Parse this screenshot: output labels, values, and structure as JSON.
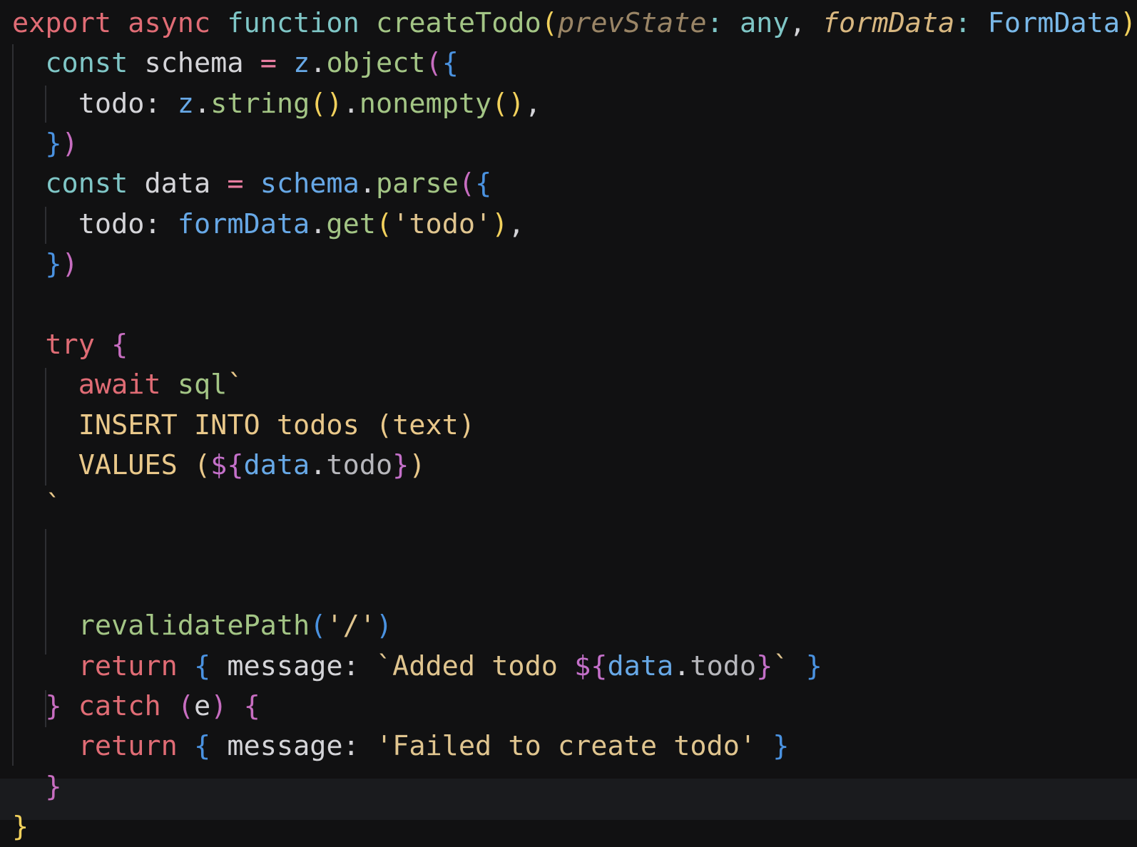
{
  "editor": {
    "lines": [
      [
        {
          "t": "export",
          "c": "kw-red"
        },
        {
          "t": " ",
          "c": "plain"
        },
        {
          "t": "async",
          "c": "kw-red"
        },
        {
          "t": " ",
          "c": "plain"
        },
        {
          "t": "function",
          "c": "kw-teal"
        },
        {
          "t": " ",
          "c": "plain"
        },
        {
          "t": "createTodo",
          "c": "fn-green"
        },
        {
          "t": "(",
          "c": "punc-yellow"
        },
        {
          "t": "prevState",
          "c": "param"
        },
        {
          "t": ": ",
          "c": "colon-teal"
        },
        {
          "t": "any",
          "c": "kw-teal"
        },
        {
          "t": ", ",
          "c": "plain"
        },
        {
          "t": "formData",
          "c": "param2"
        },
        {
          "t": ": ",
          "c": "colon-teal"
        },
        {
          "t": "FormData",
          "c": "type-blue"
        },
        {
          "t": ")",
          "c": "punc-yellow"
        }
      ],
      [
        {
          "t": "  ",
          "c": "plain"
        },
        {
          "t": "const",
          "c": "kw-teal"
        },
        {
          "t": " schema ",
          "c": "plain"
        },
        {
          "t": "=",
          "c": "op-pink"
        },
        {
          "t": " ",
          "c": "plain"
        },
        {
          "t": "z",
          "c": "obj-blue"
        },
        {
          "t": ".",
          "c": "plain"
        },
        {
          "t": "object",
          "c": "fn-green"
        },
        {
          "t": "(",
          "c": "brace-purple"
        },
        {
          "t": "{",
          "c": "brace-blue"
        }
      ],
      [
        {
          "t": "    todo: ",
          "c": "plain"
        },
        {
          "t": "z",
          "c": "obj-blue"
        },
        {
          "t": ".",
          "c": "plain"
        },
        {
          "t": "string",
          "c": "fn-green"
        },
        {
          "t": "()",
          "c": "punc-yellow"
        },
        {
          "t": ".",
          "c": "plain"
        },
        {
          "t": "nonempty",
          "c": "fn-green"
        },
        {
          "t": "()",
          "c": "punc-yellow"
        },
        {
          "t": ",",
          "c": "plain"
        }
      ],
      [
        {
          "t": "  ",
          "c": "plain"
        },
        {
          "t": "}",
          "c": "brace-blue"
        },
        {
          "t": ")",
          "c": "brace-purple"
        }
      ],
      [
        {
          "t": "  ",
          "c": "plain"
        },
        {
          "t": "const",
          "c": "kw-teal"
        },
        {
          "t": " data ",
          "c": "plain"
        },
        {
          "t": "=",
          "c": "op-pink"
        },
        {
          "t": " ",
          "c": "plain"
        },
        {
          "t": "schema",
          "c": "obj-blue"
        },
        {
          "t": ".",
          "c": "plain"
        },
        {
          "t": "parse",
          "c": "fn-green"
        },
        {
          "t": "(",
          "c": "brace-purple"
        },
        {
          "t": "{",
          "c": "brace-blue"
        }
      ],
      [
        {
          "t": "    todo: ",
          "c": "plain"
        },
        {
          "t": "formData",
          "c": "obj-blue"
        },
        {
          "t": ".",
          "c": "plain"
        },
        {
          "t": "get",
          "c": "fn-green"
        },
        {
          "t": "(",
          "c": "punc-yellow"
        },
        {
          "t": "'todo'",
          "c": "str-yellow"
        },
        {
          "t": ")",
          "c": "punc-yellow"
        },
        {
          "t": ",",
          "c": "plain"
        }
      ],
      [
        {
          "t": "  ",
          "c": "plain"
        },
        {
          "t": "}",
          "c": "brace-blue"
        },
        {
          "t": ")",
          "c": "brace-purple"
        }
      ],
      [],
      [
        {
          "t": "  ",
          "c": "plain"
        },
        {
          "t": "try",
          "c": "kw-red"
        },
        {
          "t": " ",
          "c": "plain"
        },
        {
          "t": "{",
          "c": "brace-purple"
        }
      ],
      [
        {
          "t": "    ",
          "c": "plain"
        },
        {
          "t": "await",
          "c": "kw-red"
        },
        {
          "t": " ",
          "c": "plain"
        },
        {
          "t": "sql",
          "c": "fn-green"
        },
        {
          "t": "`",
          "c": "sql-yellow"
        }
      ],
      [
        {
          "t": "    INSERT INTO todos (text)",
          "c": "sql-yellow"
        }
      ],
      [
        {
          "t": "    VALUES (",
          "c": "sql-yellow"
        },
        {
          "t": "${",
          "c": "tmpl-purple"
        },
        {
          "t": "data",
          "c": "obj-blue"
        },
        {
          "t": ".",
          "c": "plain"
        },
        {
          "t": "todo",
          "c": "dim"
        },
        {
          "t": "}",
          "c": "tmpl-purple"
        },
        {
          "t": ")",
          "c": "sql-yellow"
        }
      ],
      [
        {
          "t": "  `",
          "c": "sql-yellow"
        }
      ],
      [],
      [],
      [
        {
          "t": "    ",
          "c": "plain"
        },
        {
          "t": "revalidatePath",
          "c": "fn-green"
        },
        {
          "t": "(",
          "c": "brace-blue"
        },
        {
          "t": "'/'",
          "c": "str-yellow"
        },
        {
          "t": ")",
          "c": "brace-blue"
        }
      ],
      [
        {
          "t": "    ",
          "c": "plain"
        },
        {
          "t": "return",
          "c": "kw-red"
        },
        {
          "t": " ",
          "c": "plain"
        },
        {
          "t": "{",
          "c": "brace-blue"
        },
        {
          "t": " message: ",
          "c": "plain"
        },
        {
          "t": "`Added todo ",
          "c": "str-yellow"
        },
        {
          "t": "${",
          "c": "tmpl-purple"
        },
        {
          "t": "data",
          "c": "obj-blue"
        },
        {
          "t": ".",
          "c": "plain"
        },
        {
          "t": "todo",
          "c": "dim"
        },
        {
          "t": "}",
          "c": "tmpl-purple"
        },
        {
          "t": "`",
          "c": "str-yellow"
        },
        {
          "t": " ",
          "c": "plain"
        },
        {
          "t": "}",
          "c": "brace-blue"
        }
      ],
      [
        {
          "t": "  ",
          "c": "plain"
        },
        {
          "t": "}",
          "c": "brace-purple"
        },
        {
          "t": " ",
          "c": "plain"
        },
        {
          "t": "catch",
          "c": "kw-red"
        },
        {
          "t": " ",
          "c": "plain"
        },
        {
          "t": "(",
          "c": "brace-purple"
        },
        {
          "t": "e",
          "c": "plain"
        },
        {
          "t": ")",
          "c": "brace-purple"
        },
        {
          "t": " ",
          "c": "plain"
        },
        {
          "t": "{",
          "c": "brace-purple"
        }
      ],
      [
        {
          "t": "    ",
          "c": "plain"
        },
        {
          "t": "return",
          "c": "kw-red"
        },
        {
          "t": " ",
          "c": "plain"
        },
        {
          "t": "{",
          "c": "brace-blue"
        },
        {
          "t": " message: ",
          "c": "plain"
        },
        {
          "t": "'Failed to create todo'",
          "c": "str-yellow"
        },
        {
          "t": " ",
          "c": "plain"
        },
        {
          "t": "}",
          "c": "brace-blue"
        }
      ],
      [
        {
          "t": "  ",
          "c": "plain"
        },
        {
          "t": "}",
          "c": "brace-purple"
        }
      ],
      [
        {
          "t": "}",
          "c": "punc-yellow"
        }
      ]
    ]
  }
}
